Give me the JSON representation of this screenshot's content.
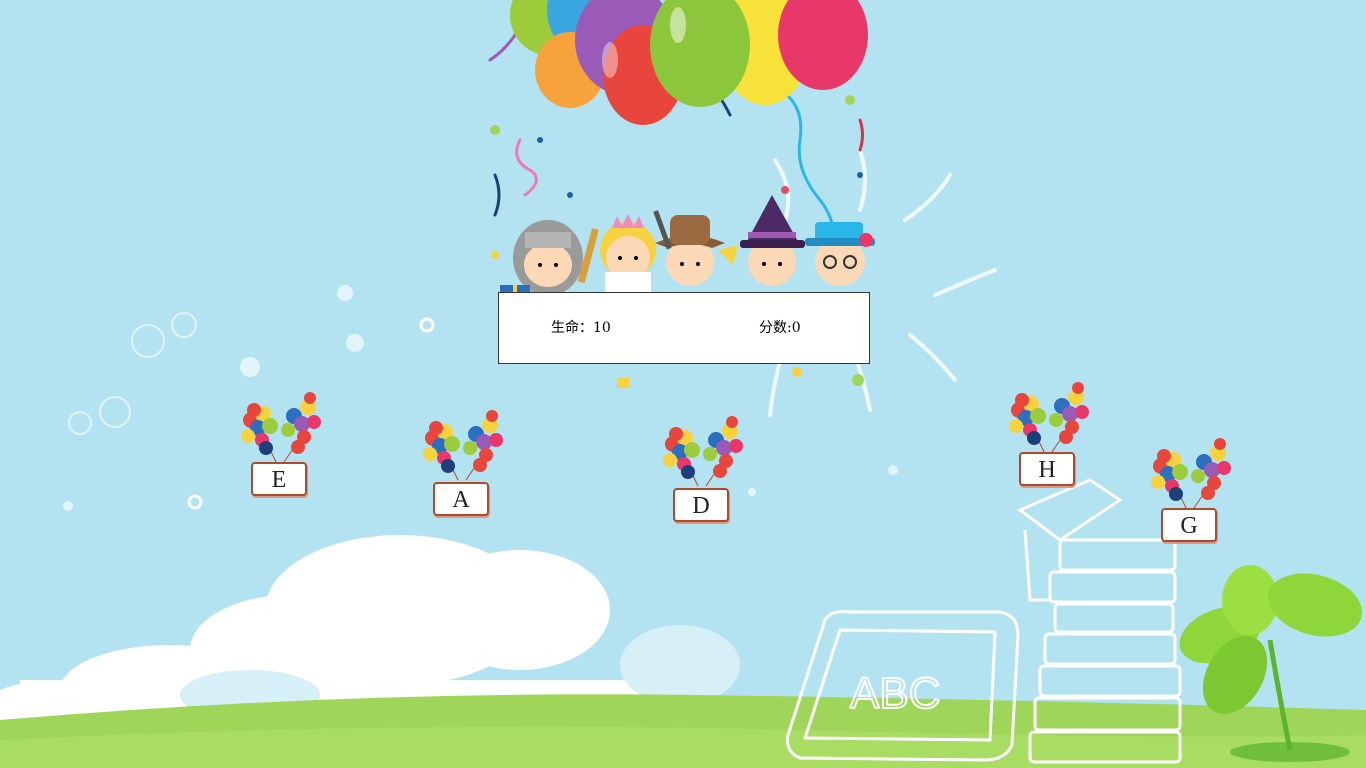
{
  "hud": {
    "lives_label": "生命：10",
    "score_label": "分数:0"
  },
  "letters": [
    "E",
    "A",
    "D",
    "H",
    "G"
  ],
  "colors": {
    "sky": "#b3e3f1",
    "grass_light": "#9fd65a",
    "grass_dark": "#6fbf3a",
    "card_border": "#b04a2c"
  }
}
